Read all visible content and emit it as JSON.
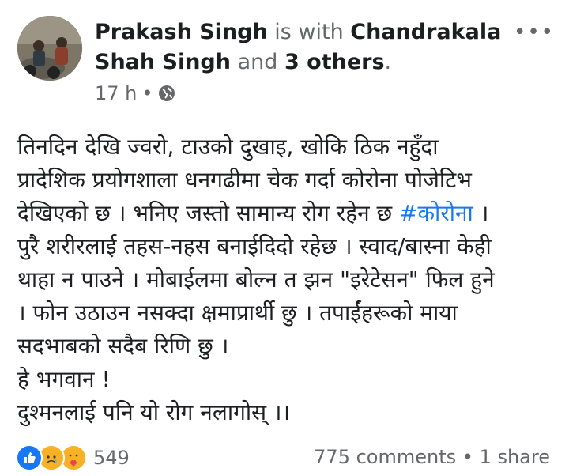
{
  "header": {
    "author": "Prakash Singh",
    "with_word": "is with",
    "tagged_line1": "Chandrakala",
    "tagged_line2": "Shah Singh",
    "and_word": "and",
    "others": "3 others",
    "period": ".",
    "time": "17 h",
    "separator": "•",
    "more_icon": "more-options-icon",
    "privacy_icon": "globe-icon"
  },
  "post": {
    "lines": [
      "तिनदिन देखि ज्वरो, टाउको दुखाइ, खोकि ठिक नहुँदा",
      "प्रादेशिक प्रयोगशाला धनगढीमा चेक गर्दा कोरोना पोजेटिभ",
      "देखिएको छ ।  भनिए जस्तो सामान्य रोग रहेन छ ",
      "पुरै शरीरलाई तहस-नहस बनाईदिदो रहेछ । स्वाद/बास्ना केही",
      "थाहा न पाउने । मोबाईलमा बोल्न त झन \"इरेटेसन\" फिल हुने",
      "। फोन उठाउन नसक्दा क्षमाप्रार्थी छु । तपाईंहरूको माया",
      "सदभाबको सदैब रिणि छु ।",
      "हे भगवान !",
      "दुश्मनलाई पनि यो रोग नलागोस्  ।।"
    ],
    "hashtag": "#कोरोना",
    "hashtag_suffix": " ।"
  },
  "footer": {
    "reaction_count": "549",
    "comments": "775 comments",
    "separator": "•",
    "shares": "1 share",
    "reaction_icons": [
      "like-icon",
      "sad-icon",
      "care-icon"
    ]
  },
  "colors": {
    "link": "#1877f2",
    "muted": "#65676b",
    "text": "#1c1e21"
  }
}
